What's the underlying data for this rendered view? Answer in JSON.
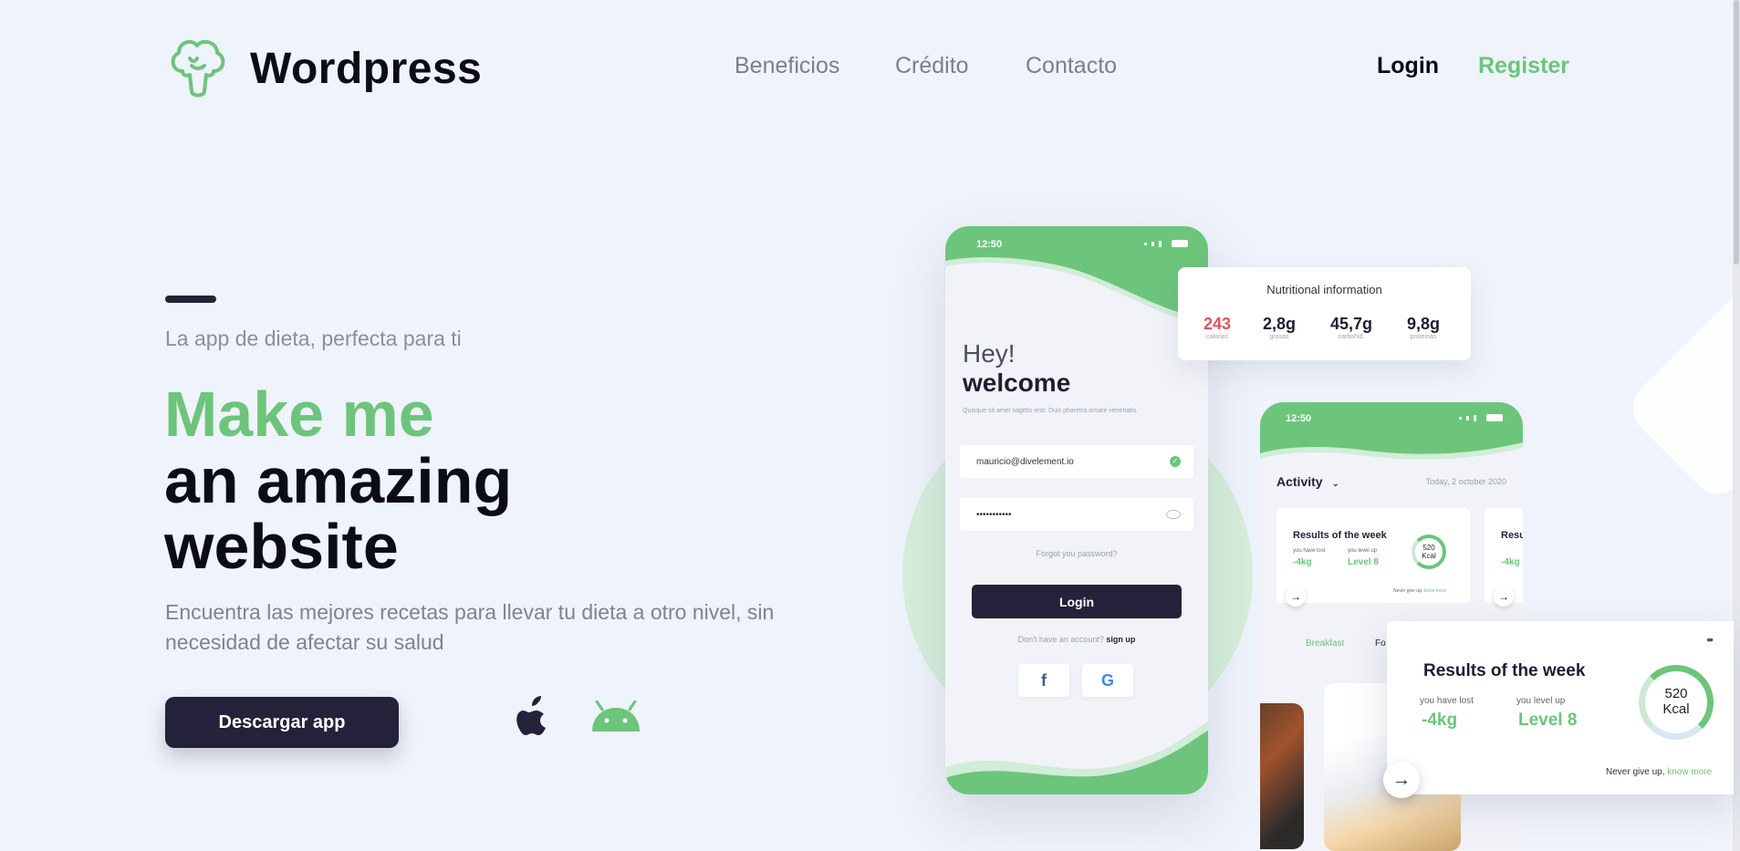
{
  "header": {
    "brand": "Wordpress",
    "logo_icon": "broccoli-icon",
    "nav": [
      "Beneficios",
      "Crédito",
      "Contacto"
    ],
    "login": "Login",
    "register": "Register"
  },
  "hero": {
    "tagline": "La app de dieta, perfecta para ti",
    "headline_green": "Make me",
    "headline_line2": "an amazing",
    "headline_line3": "website",
    "description": "Encuentra las mejores recetas para llevar tu dieta a otro nivel, sin necesidad de afectar su salud",
    "cta": "Descargar app",
    "platform_icons": [
      "apple-icon",
      "android-icon"
    ]
  },
  "colors": {
    "accent": "#6cc57b",
    "dark": "#23223a",
    "background": "#eff3fb",
    "calories": "#e8525a"
  },
  "phone_login": {
    "time": "12:50",
    "greeting": "Hey!",
    "welcome": "welcome",
    "lorem": "Quisque sit amet sagittis erat. Duis pharetra ornare venenatis.",
    "email": "mauricio@divelement.io",
    "password": "•••••••••••",
    "forgot": "Forgot you password?",
    "login": "Login",
    "no_account": "Don't have an account?",
    "sign_up": "sign up",
    "social": [
      "f",
      "G"
    ]
  },
  "nutrition": {
    "title": "Nutritional information",
    "items": [
      {
        "value": "243",
        "label": "calorias"
      },
      {
        "value": "2,8g",
        "label": "grasas"
      },
      {
        "value": "45,7g",
        "label": "carbohid."
      },
      {
        "value": "9,8g",
        "label": "proteinas"
      }
    ]
  },
  "phone_activity": {
    "time": "12:50",
    "title": "Activity",
    "date": "Today, 2 october 2020",
    "card_title": "Results of the week",
    "card_title_cut": "Resu",
    "lost_label": "you have lost",
    "lost_value": "-4kg",
    "level_label": "you level up",
    "level_value": "Level 8",
    "ring_value": "520",
    "ring_unit": "Kcal",
    "foot": "Never give up,",
    "foot_link": "know more",
    "tabs": [
      "Breakfast",
      "Fo"
    ]
  },
  "results_card": {
    "title": "Results of the week",
    "lost_label": "you have lost",
    "lost_value": "-4kg",
    "level_label": "you level up",
    "level_value": "Level 8",
    "ring_value": "520",
    "ring_unit": "Kcal",
    "foot": "Never give up,",
    "foot_link": "know more"
  }
}
